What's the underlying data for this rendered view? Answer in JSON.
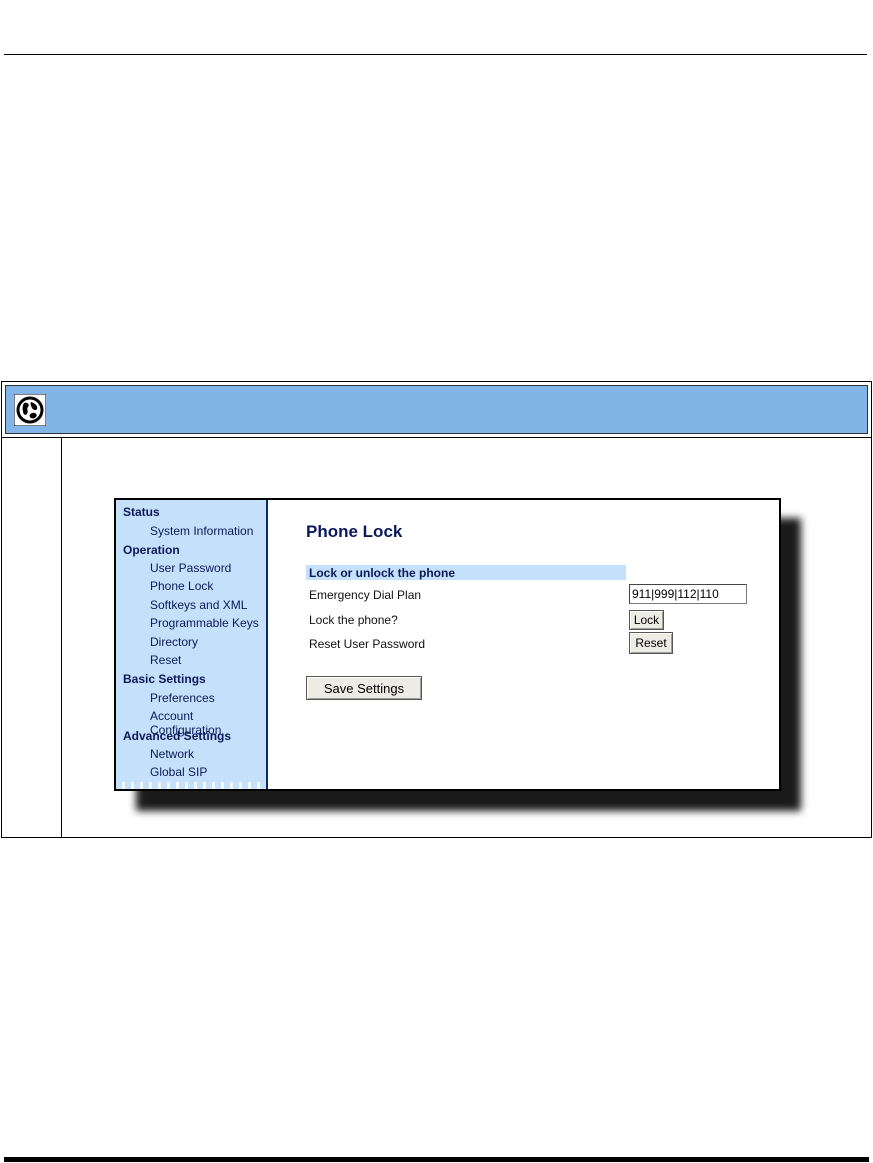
{
  "screenshot": {
    "nav": {
      "groups": [
        {
          "label": "Status",
          "items": [
            "System Information"
          ]
        },
        {
          "label": "Operation",
          "items": [
            "User Password",
            "Phone Lock",
            "Softkeys and XML",
            "Programmable Keys",
            "Directory",
            "Reset"
          ]
        },
        {
          "label": "Basic Settings",
          "items": [
            "Preferences",
            "Account Configuration"
          ]
        },
        {
          "label": "Advanced Settings",
          "items": [
            "Network",
            "Global SIP"
          ]
        }
      ]
    },
    "page_title": "Phone Lock",
    "section_title": "Lock or unlock the phone",
    "rows": {
      "emergency_label": "Emergency Dial Plan",
      "emergency_value": "911|999|112|110",
      "lock_label": "Lock the phone?",
      "lock_button": "Lock",
      "reset_label": "Reset User Password",
      "reset_button": "Reset"
    },
    "save_button": "Save Settings"
  },
  "icons": {
    "procedure_icon": "web-globe-icon"
  },
  "colors": {
    "header_band": "#82b4e8",
    "nav_background": "#c5e0fa",
    "nav_text": "#0b1a5a"
  }
}
